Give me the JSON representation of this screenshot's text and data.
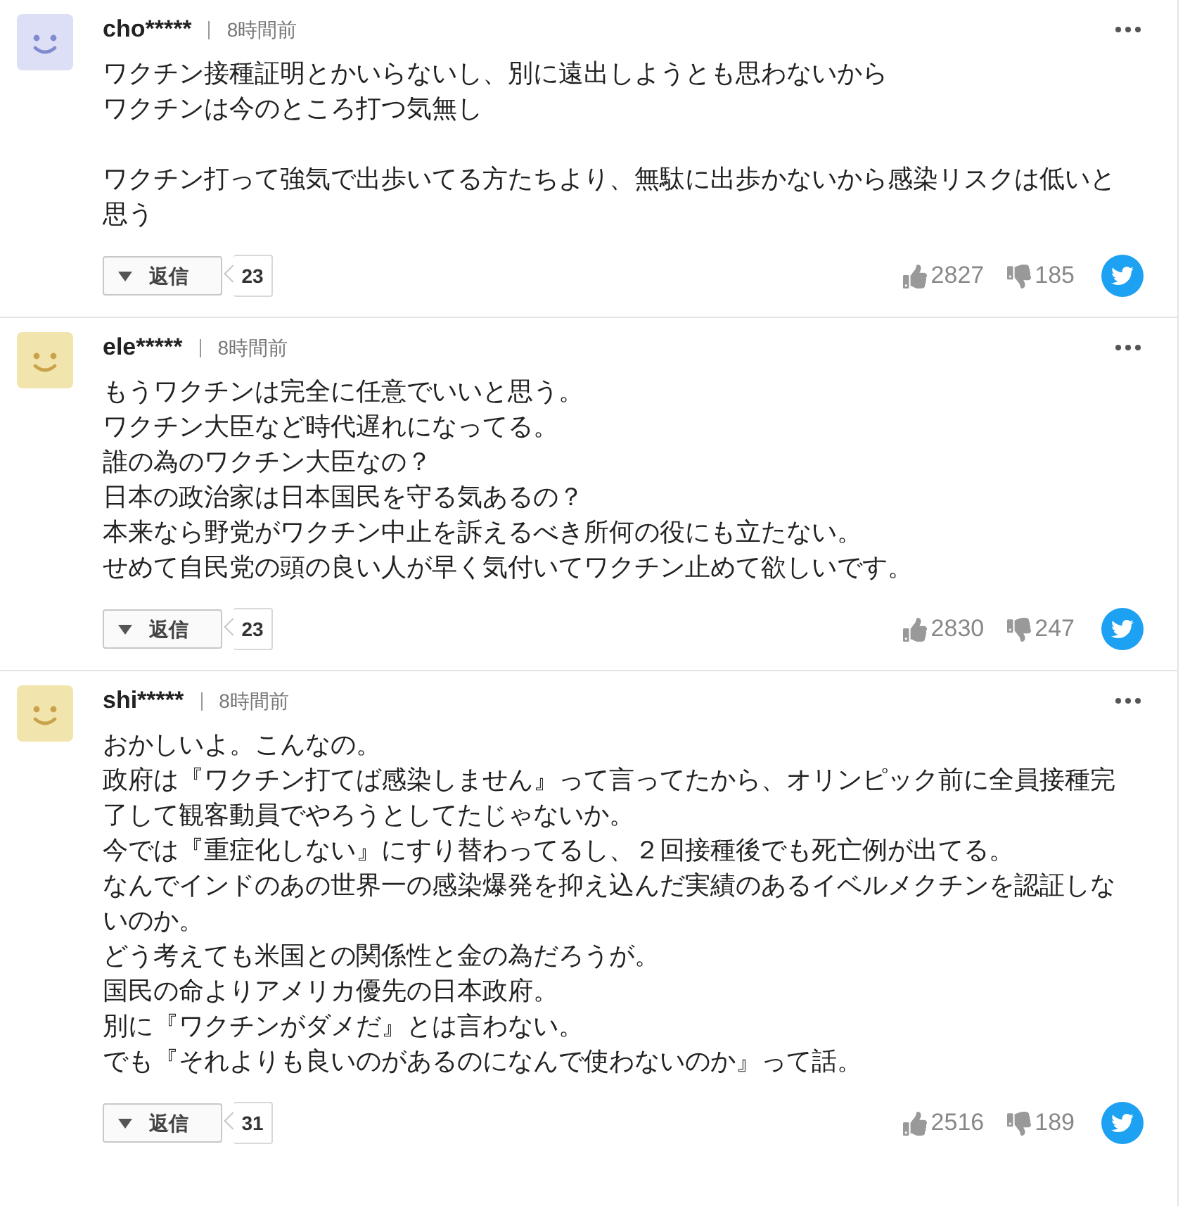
{
  "comments": [
    {
      "user": "cho*****",
      "time": "8時間前",
      "color": "#dcdff5",
      "paragraphs": [
        [
          "ワクチン接種証明とかいらないし、別に遠出しようとも思わないから",
          "ワクチンは今のところ打つ気無し"
        ],
        [
          "ワクチン打って強気で出歩いてる方たちより、無駄に出歩かないから感染リスクは低いと思う"
        ]
      ],
      "reply_label": "返信",
      "reply_count": "23",
      "likes": "2827",
      "dislikes": "185"
    },
    {
      "user": "ele*****",
      "time": "8時間前",
      "color": "#f2e4ad",
      "paragraphs": [
        [
          "もうワクチンは完全に任意でいいと思う。",
          "ワクチン大臣など時代遅れになってる。",
          "誰の為のワクチン大臣なの？",
          "日本の政治家は日本国民を守る気あるの？",
          "本来なら野党がワクチン中止を訴えるべき所何の役にも立たない。",
          "せめて自民党の頭の良い人が早く気付いてワクチン止めて欲しいです。"
        ]
      ],
      "reply_label": "返信",
      "reply_count": "23",
      "likes": "2830",
      "dislikes": "247"
    },
    {
      "user": "shi*****",
      "time": "8時間前",
      "color": "#f2e4ad",
      "paragraphs": [
        [
          "おかしいよ。こんなの。",
          "政府は『ワクチン打てば感染しません』って言ってたから、オリンピック前に全員接種完了して観客動員でやろうとしてたじゃないか。",
          "今では『重症化しない』にすり替わってるし、２回接種後でも死亡例が出てる。",
          "なんでインドのあの世界一の感染爆発を抑え込んだ実績のあるイベルメクチンを認証しないのか。",
          "どう考えても米国との関係性と金の為だろうが。",
          "国民の命よりアメリカ優先の日本政府。",
          "別に『ワクチンがダメだ』とは言わない。",
          "でも『それよりも良いのがあるのになんで使わないのか』って話。"
        ]
      ],
      "reply_label": "返信",
      "reply_count": "31",
      "likes": "2516",
      "dislikes": "189"
    }
  ]
}
